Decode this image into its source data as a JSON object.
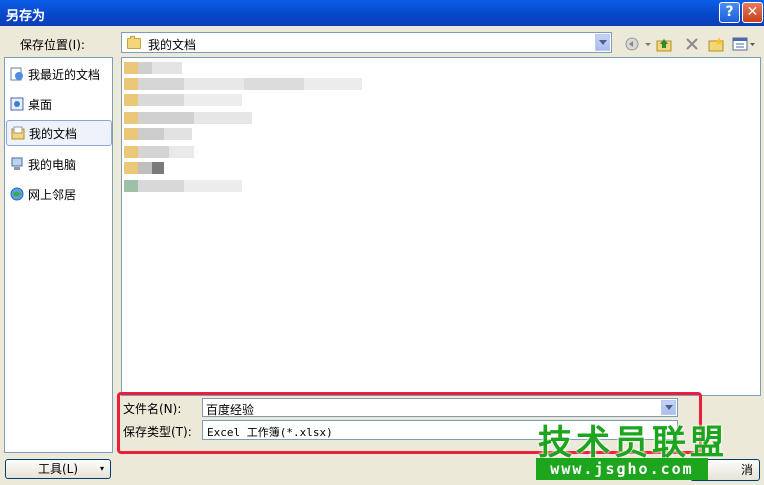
{
  "window": {
    "title": "另存为"
  },
  "location": {
    "label": "保存位置(I):",
    "value": "我的文档"
  },
  "places": [
    {
      "label": "我最近的文档",
      "icon": "recent-documents-icon"
    },
    {
      "label": "桌面",
      "icon": "desktop-icon"
    },
    {
      "label": "我的文档",
      "icon": "my-documents-icon",
      "selected": true
    },
    {
      "label": "我的电脑",
      "icon": "my-computer-icon"
    },
    {
      "label": "网上邻居",
      "icon": "network-places-icon"
    }
  ],
  "filename": {
    "label": "文件名(N):",
    "value": "百度经验"
  },
  "filetype": {
    "label": "保存类型(T):",
    "value": "Excel 工作簿(*.xlsx)"
  },
  "buttons": {
    "tools": "工具(L)",
    "cancel_partial": "消"
  },
  "watermark": {
    "brand": "技术员联盟",
    "url": "www.jsgho.com"
  }
}
